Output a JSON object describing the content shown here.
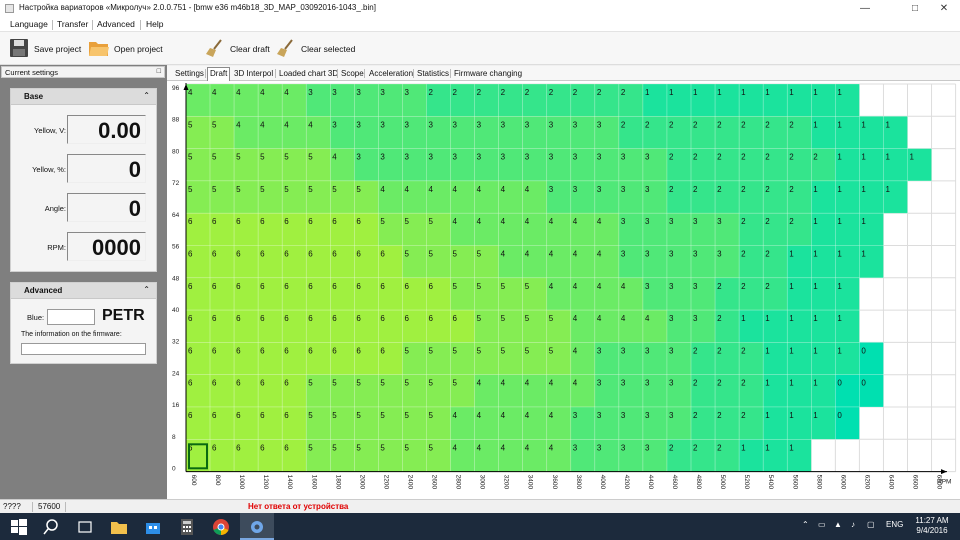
{
  "window": {
    "title": "Настройка вариаторов «Микролуч» 2.0.0.751 - [bmw e36 m46b18_3D_MAP_03092016-1043_.bin]"
  },
  "menu": {
    "items": [
      "Language",
      "Transfer",
      "Advanced",
      "Help"
    ]
  },
  "toolbar": {
    "save_project": "Save project",
    "open_project": "Open project",
    "clear_draft": "Clear draft",
    "clear_selected": "Clear selected"
  },
  "left_panel": {
    "header": "Current settings",
    "base": {
      "title": "Base",
      "fields": [
        {
          "label": "Yellow, V:",
          "value": "0.00"
        },
        {
          "label": "Yellow, %:",
          "value": "0"
        },
        {
          "label": "Angle:",
          "value": "0"
        },
        {
          "label": "RPM:",
          "value": "0000"
        }
      ]
    },
    "advanced": {
      "title": "Advanced",
      "blue_label": "Blue:",
      "blue_value": "PETR",
      "firmware_info_label": "The information on the firmware:"
    }
  },
  "tabs": [
    "Settings",
    "Draft",
    "3D Interpol",
    "Loaded chart 3D",
    "Scope",
    "Acceleration",
    "Statistics",
    "Firmware changing"
  ],
  "active_tab": "Draft",
  "status": {
    "left": "????",
    "code": "57600",
    "message": "Нет ответа от устройства",
    "message_color": "#e00000"
  },
  "taskbar": {
    "lang": "ENG",
    "time": "11:27 AM",
    "date": "9/4/2016"
  },
  "colors": {
    "accent": "#0078d7",
    "heat_high": "#a0f040",
    "heat_low": "#00e0b0"
  },
  "chart_data": {
    "type": "heatmap",
    "x_label": "RPM",
    "x": [
      600,
      800,
      1000,
      1200,
      1400,
      1600,
      1800,
      2000,
      2200,
      2400,
      2600,
      2800,
      3000,
      3200,
      3400,
      3600,
      3800,
      4000,
      4200,
      4400,
      4600,
      4800,
      5000,
      5200,
      5400,
      5600,
      5800,
      6000,
      6200,
      6400,
      6600,
      6800
    ],
    "y_ticks": [
      0,
      8,
      16,
      24,
      32,
      40,
      48,
      56,
      64,
      72,
      80,
      88,
      96
    ],
    "rows": [
      [
        4,
        4,
        4,
        4,
        4,
        3,
        3,
        3,
        3,
        3,
        2,
        2,
        2,
        2,
        2,
        2,
        2,
        2,
        2,
        1,
        1,
        1,
        1,
        1,
        1,
        1,
        1,
        1
      ],
      [
        5,
        5,
        4,
        4,
        4,
        4,
        3,
        3,
        3,
        3,
        3,
        3,
        3,
        3,
        3,
        3,
        3,
        3,
        2,
        2,
        2,
        2,
        2,
        2,
        2,
        2,
        1,
        1,
        1,
        1
      ],
      [
        5,
        5,
        5,
        5,
        5,
        5,
        4,
        3,
        3,
        3,
        3,
        3,
        3,
        3,
        3,
        3,
        3,
        3,
        3,
        3,
        2,
        2,
        2,
        2,
        2,
        2,
        2,
        1,
        1,
        1,
        1
      ],
      [
        5,
        5,
        5,
        5,
        5,
        5,
        5,
        5,
        4,
        4,
        4,
        4,
        4,
        4,
        4,
        3,
        3,
        3,
        3,
        3,
        2,
        2,
        2,
        2,
        2,
        2,
        1,
        1,
        1,
        1
      ],
      [
        6,
        6,
        6,
        6,
        6,
        6,
        6,
        6,
        5,
        5,
        5,
        4,
        4,
        4,
        4,
        4,
        4,
        4,
        3,
        3,
        3,
        3,
        3,
        2,
        2,
        2,
        1,
        1,
        1
      ],
      [
        6,
        6,
        6,
        6,
        6,
        6,
        6,
        6,
        6,
        5,
        5,
        5,
        5,
        4,
        4,
        4,
        4,
        4,
        3,
        3,
        3,
        3,
        3,
        2,
        2,
        1,
        1,
        1,
        1
      ],
      [
        6,
        6,
        6,
        6,
        6,
        6,
        6,
        6,
        6,
        6,
        6,
        5,
        5,
        5,
        5,
        4,
        4,
        4,
        4,
        3,
        3,
        3,
        2,
        2,
        2,
        1,
        1,
        1
      ],
      [
        6,
        6,
        6,
        6,
        6,
        6,
        6,
        6,
        6,
        6,
        6,
        6,
        5,
        5,
        5,
        5,
        4,
        4,
        4,
        4,
        3,
        3,
        2,
        1,
        1,
        1,
        1,
        1
      ],
      [
        6,
        6,
        6,
        6,
        6,
        6,
        6,
        6,
        6,
        5,
        5,
        5,
        5,
        5,
        5,
        5,
        4,
        3,
        3,
        3,
        3,
        2,
        2,
        2,
        1,
        1,
        1,
        1,
        0
      ],
      [
        6,
        6,
        6,
        6,
        6,
        5,
        5,
        5,
        5,
        5,
        5,
        5,
        4,
        4,
        4,
        4,
        4,
        3,
        3,
        3,
        3,
        2,
        2,
        2,
        1,
        1,
        1,
        0,
        0
      ],
      [
        6,
        6,
        6,
        6,
        6,
        5,
        5,
        5,
        5,
        5,
        5,
        4,
        4,
        4,
        4,
        4,
        3,
        3,
        3,
        3,
        3,
        2,
        2,
        2,
        1,
        1,
        1,
        0
      ],
      [
        6,
        6,
        6,
        6,
        6,
        5,
        5,
        5,
        5,
        5,
        5,
        4,
        4,
        4,
        4,
        4,
        3,
        3,
        3,
        3,
        2,
        2,
        2,
        1,
        1,
        1
      ]
    ]
  }
}
